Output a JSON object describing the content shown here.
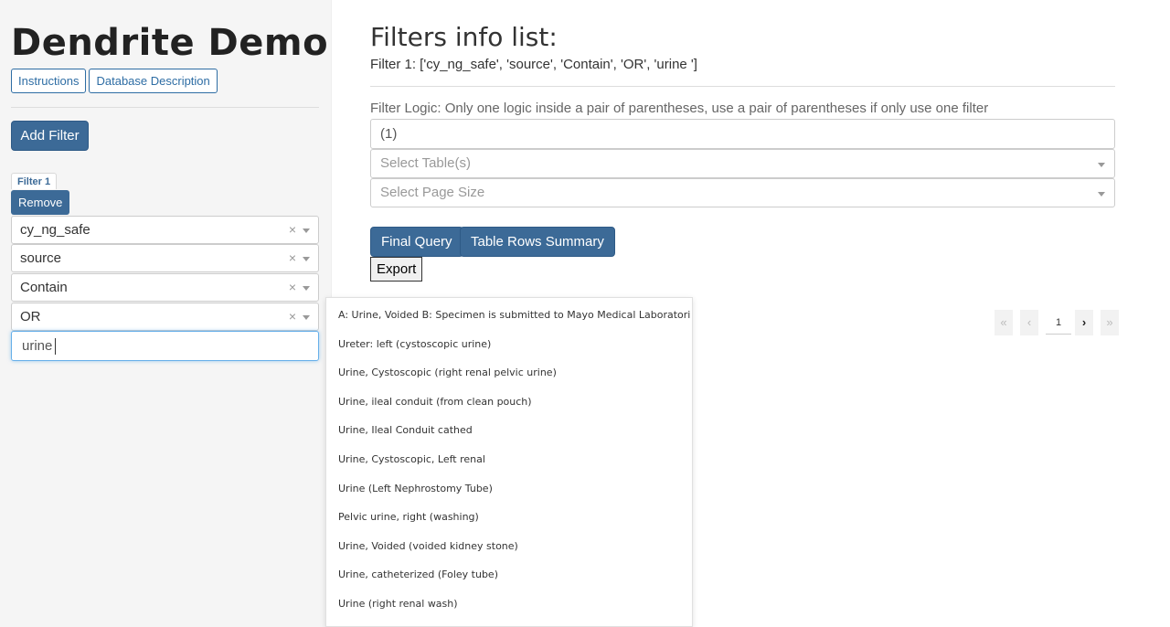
{
  "sidebar": {
    "title": "Dendrite Demo",
    "instructions_label": "Instructions",
    "db_description_label": "Database Description",
    "add_filter_label": "Add Filter",
    "filter_tab_label": "Filter 1",
    "remove_label": "Remove",
    "selects": [
      {
        "value": "cy_ng_safe"
      },
      {
        "value": "source"
      },
      {
        "value": "Contain"
      },
      {
        "value": "OR"
      }
    ],
    "search_value": "urine",
    "clear_glyph": "×"
  },
  "main": {
    "title": "Filters info list:",
    "filter_line": "Filter 1: ['cy_ng_safe', 'source', 'Contain', 'OR', 'urine ']",
    "logic_label": "Filter Logic: Only one logic inside a pair of parentheses, use a pair of parentheses if only use one filter",
    "logic_value": "(1)",
    "table_placeholder": "Select Table(s)",
    "page_size_placeholder": "Select Page Size",
    "final_query_label": "Final Query",
    "table_rows_label": "Table Rows Summary",
    "export_label": "Export"
  },
  "dropdown_options": [
    "A: Urine, Voided B: Specimen is submitted to Mayo Medical Laboratori",
    "Ureter: left (cystoscopic urine)",
    "Urine, Cystoscopic (right renal pelvic urine)",
    "Urine, ileal conduit (from clean pouch)",
    "Urine, Ileal Conduit cathed",
    "Urine, Cystoscopic, Left renal",
    "Urine (Left Nephrostomy Tube)",
    "Pelvic urine, right (washing)",
    "Urine, Voided (voided kidney stone)",
    "Urine, catheterized (Foley tube)",
    "Urine (right renal wash)"
  ],
  "pagination": {
    "first_glyph": "«",
    "prev_glyph": "‹",
    "page_number": "1",
    "next_glyph": "›",
    "last_glyph": "»"
  },
  "colors": {
    "primary": "#3c6a97",
    "sidebar_bg": "#f5f5f5"
  }
}
